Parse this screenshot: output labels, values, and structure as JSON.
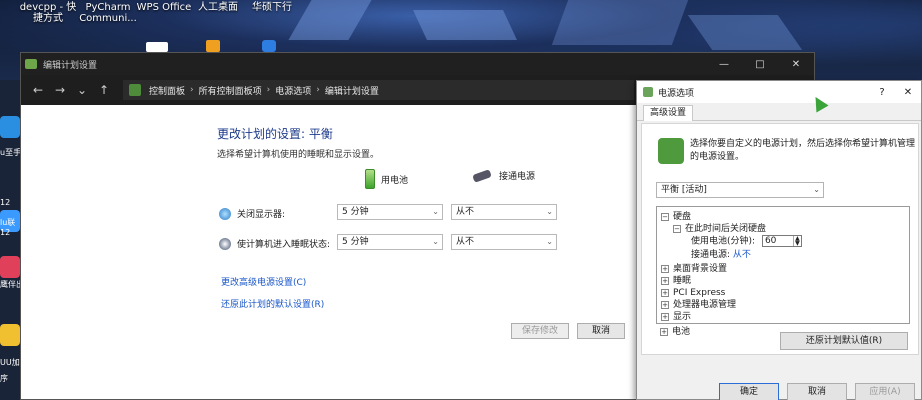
{
  "desktop": {
    "icons": [
      "devcpp - 快捷方式",
      "PyCharm Communi...",
      "WPS Office",
      "人工桌面",
      "华硕下行"
    ],
    "left_labels": [
      "u至手",
      "12",
      "lu联",
      "12",
      "鹰伴出",
      "UU加速器",
      "序"
    ]
  },
  "main_window": {
    "title": "编辑计划设置",
    "controls": {
      "min": "—",
      "max": "□",
      "close": "✕"
    },
    "nav": {
      "back": "←",
      "forward": "→",
      "down": "⌄",
      "up": "↑"
    },
    "breadcrumb": [
      "控制面板",
      "所有控制面板项",
      "电源选项",
      "编辑计划设置"
    ],
    "breadcrumb_sep": "›",
    "heading": "更改计划的设置: 平衡",
    "subheading": "选择希望计算机使用的睡眠和显示设置。",
    "col_battery": "用电池",
    "col_plugged": "接通电源",
    "rows": [
      {
        "label": "关闭显示器:",
        "battery": "5 分钟",
        "plugged": "从不"
      },
      {
        "label": "使计算机进入睡眠状态:",
        "battery": "5 分钟",
        "plugged": "从不"
      }
    ],
    "link_advanced": "更改高级电源设置(C)",
    "link_restore": "还原此计划的默认设置(R)",
    "btn_save": "保存修改",
    "btn_cancel": "取消"
  },
  "power_dialog": {
    "title": "电源选项",
    "help": "?",
    "close": "✕",
    "tab": "高级设置",
    "description": "选择你要自定义的电源计划，然后选择你希望计算机管理的电源设置。",
    "plan": "平衡 [活动]",
    "tree": {
      "disk": "硬盘",
      "disk_child": "在此时间后关闭硬盘",
      "on_battery_label": "使用电池(分钟):",
      "on_battery_value": "60",
      "plugged_label": "接通电源:",
      "plugged_value": "从不",
      "items": [
        "桌面背景设置",
        "睡眠",
        "PCI Express",
        "处理器电源管理",
        "显示",
        "电池"
      ]
    },
    "btn_restore": "还原计划默认值(R)",
    "btn_ok": "确定",
    "btn_cancel": "取消",
    "btn_apply": "应用(A)"
  }
}
